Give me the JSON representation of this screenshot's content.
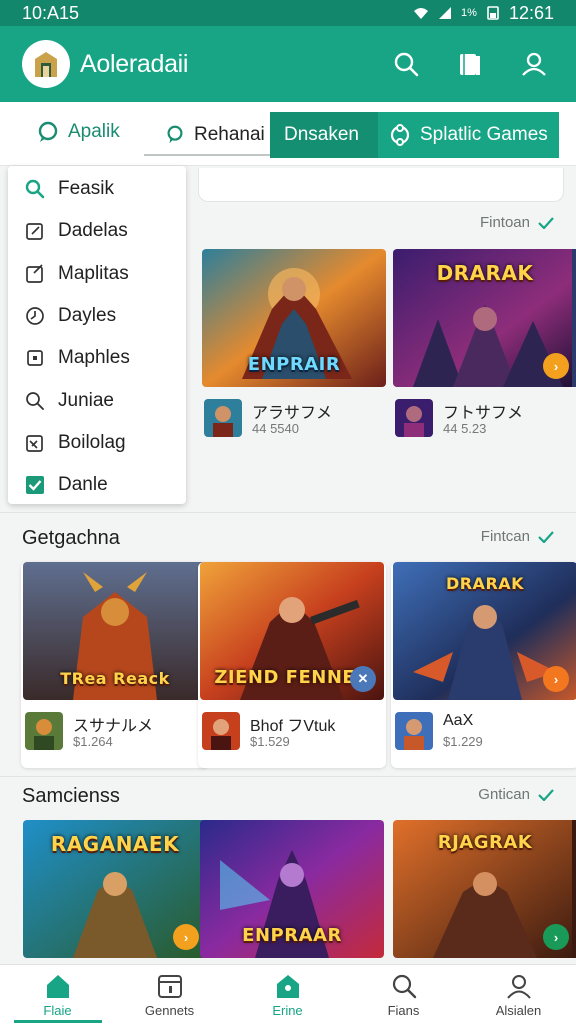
{
  "status_bar": {
    "time": "10:A15",
    "battery_text": "1%",
    "clock_right": "12:61"
  },
  "app_bar": {
    "title": "Aoleradaii",
    "icons": [
      "search-icon",
      "book-icon",
      "profile-icon"
    ]
  },
  "tabs": [
    {
      "label": "Apalik",
      "icon": "chat-icon"
    },
    {
      "label": "Rehanai",
      "icon": "chat-icon"
    },
    {
      "label": "Dnsaken",
      "icon": ""
    },
    {
      "label": "Splatlic Games",
      "icon": "gamepad-icon"
    }
  ],
  "menu": {
    "items": [
      {
        "label": "Feasik",
        "icon": "search-icon"
      },
      {
        "label": "Dadelas",
        "icon": "edit-icon"
      },
      {
        "label": "Maplitas",
        "icon": "edit-icon"
      },
      {
        "label": "Dayles",
        "icon": "clock-icon"
      },
      {
        "label": "Maphles",
        "icon": "square-icon"
      },
      {
        "label": "Juniae",
        "icon": "search-icon"
      },
      {
        "label": "Boilolag",
        "icon": "image-icon"
      },
      {
        "label": "Danle",
        "icon": "check-icon"
      }
    ]
  },
  "sections": [
    {
      "title": "",
      "action": "Fintoan",
      "games": [
        {
          "art_title": "ENPRAIR",
          "name": "アラサフメ",
          "stat": "44 5540",
          "badge": ""
        },
        {
          "art_title": "DRARAK",
          "name": "フトサフメ",
          "stat": "44 5.23",
          "badge": "›"
        }
      ]
    },
    {
      "title": "Getgachna",
      "action": "Fintcan",
      "games": [
        {
          "art_title": "TRea Reack",
          "name": "スサナルメ",
          "stat": "$1.264",
          "badge": ""
        },
        {
          "art_title": "ZIEND FENNEK",
          "name": "Bhof フVtuk",
          "stat": "$1.529",
          "badge": "✕"
        },
        {
          "art_title": "DRARAK",
          "name": "AaX",
          "stat": "$1.229",
          "badge": "›"
        }
      ]
    },
    {
      "title": "Samcienss",
      "action": "Gntican",
      "games": [
        {
          "art_title": "RAGANAEK",
          "badge": "›"
        },
        {
          "art_title": "ENPRAAR",
          "badge": ""
        },
        {
          "art_title": "RJAGRAK",
          "badge": "›"
        }
      ]
    }
  ],
  "bottom_nav": [
    {
      "label": "Flaie",
      "icon": "home-icon",
      "active": true
    },
    {
      "label": "Gennets",
      "icon": "calendar-icon",
      "active": false
    },
    {
      "label": "Erine",
      "icon": "home-icon",
      "active": true
    },
    {
      "label": "Fians",
      "icon": "search-icon",
      "active": false
    },
    {
      "label": "Alsialen",
      "icon": "profile-icon",
      "active": false
    }
  ],
  "colors": {
    "accent": "#17a585",
    "accent_dark": "#148f72",
    "status_bar": "#13876b",
    "gold_title": "#ffd34a"
  }
}
